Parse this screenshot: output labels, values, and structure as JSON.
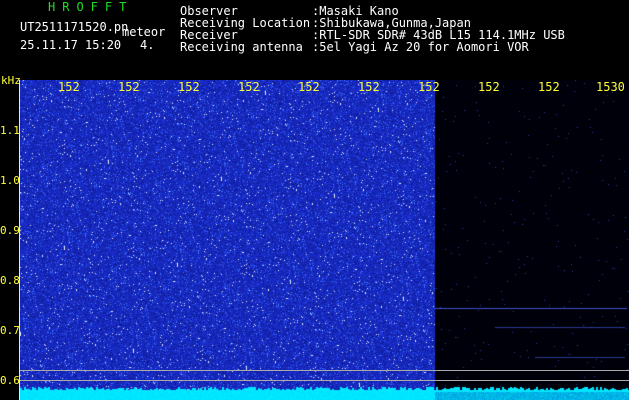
{
  "header": {
    "title": "HROFFT",
    "filename": "UT2511171520.pn",
    "filename_suffix": "meteor",
    "datetime": "25.11.17 15:20",
    "counter": "4."
  },
  "info": [
    {
      "label": "Observer",
      "value": ":Masaki Kano"
    },
    {
      "label": "Receiving Location",
      "value": ":Shibukawa,Gunma,Japan"
    },
    {
      "label": "Receiver",
      "value": ":RTL-SDR SDR# 43dB L15 114.1MHz USB"
    },
    {
      "label": "Receiving antenna",
      "value": ":5el Yagi Az 20 for Aomori VOR"
    }
  ],
  "axes": {
    "y_unit": "kHz",
    "y_ticks": [
      "1.1",
      "1.0",
      "0.9",
      "0.8",
      "0.7",
      "0.6"
    ],
    "x_ticks": [
      "152",
      "152",
      "152",
      "152",
      "152",
      "152",
      "152",
      "152",
      "152",
      "1530"
    ]
  },
  "colors": {
    "label_green": "#22dd22",
    "axis_yellow": "#ffff33",
    "spectrogram_blue": "#1a28c8",
    "noise_floor_cyan": "#00e6ff"
  }
}
